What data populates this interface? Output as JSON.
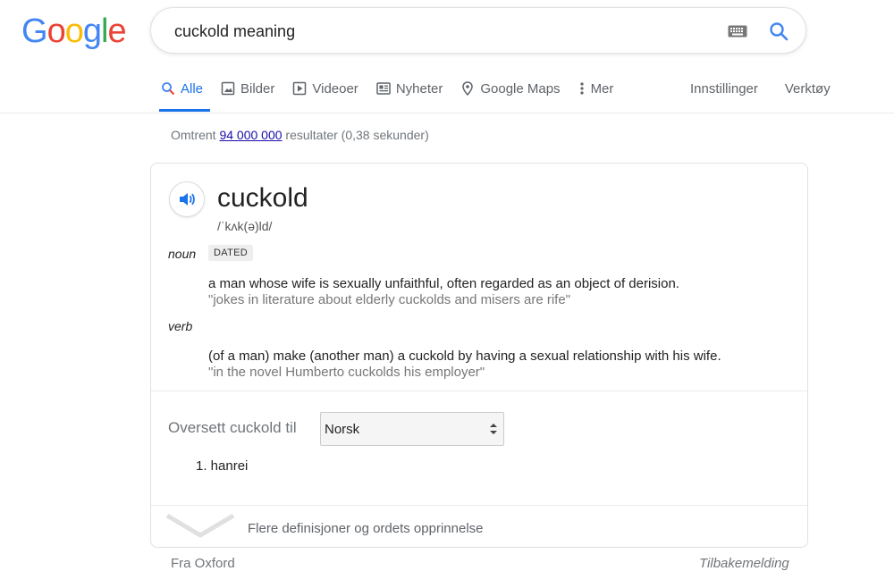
{
  "logo": {
    "letters": [
      "G",
      "o",
      "o",
      "g",
      "l",
      "e"
    ],
    "colors": [
      "#4285F4",
      "#EA4335",
      "#FBBC05",
      "#4285F4",
      "#34A853",
      "#EA4335"
    ]
  },
  "search": {
    "value": "cuckold meaning"
  },
  "icons": {
    "keyboard": "keyboard-icon",
    "search": "search-icon",
    "speaker": "speaker-icon"
  },
  "tabs": [
    {
      "label": "Alle",
      "icon": "search-icon",
      "active": true
    },
    {
      "label": "Bilder",
      "icon": "image-icon"
    },
    {
      "label": "Videoer",
      "icon": "video-icon"
    },
    {
      "label": "Nyheter",
      "icon": "news-icon"
    },
    {
      "label": "Google Maps",
      "icon": "map-pin-icon"
    },
    {
      "label": "Mer",
      "icon": "more-vert-icon"
    }
  ],
  "tools": {
    "settings": "Innstillinger",
    "tools": "Verktøy"
  },
  "stats": {
    "prefix": "Omtrent ",
    "count": "94 000 000",
    "suffix": " resultater (0,38 sekunder)"
  },
  "dictionary": {
    "word": "cuckold",
    "phonetic": "/ˈkʌk(ə)ld/",
    "entries": [
      {
        "pos": "noun",
        "label": "DATED",
        "definition": "a man whose wife is sexually unfaithful, often regarded as an object of derision.",
        "example": "\"jokes in literature about elderly cuckolds and misers are rife\""
      },
      {
        "pos": "verb",
        "definition": "(of a man) make (another man) a cuckold by having a sexual relationship with his wife.",
        "example": "\"in the novel Humberto cuckolds his employer\""
      }
    ],
    "translate_label": "Oversett cuckold til",
    "language": "Norsk",
    "translations": [
      "1. hanrei"
    ],
    "more": "Flere definisjoner og ordets opprinnelse"
  },
  "footer": {
    "source": "Fra Oxford",
    "feedback": "Tilbakemelding"
  },
  "colors": {
    "accent": "#1a73e8",
    "link": "#1a0dab"
  }
}
